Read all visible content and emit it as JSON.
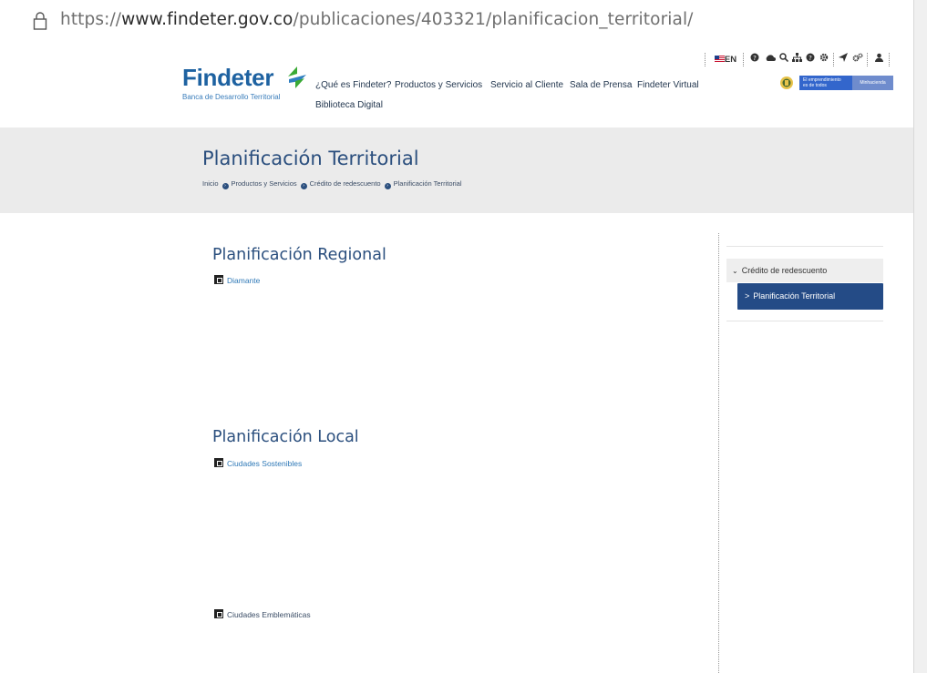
{
  "address_bar": {
    "url_prefix": "https://",
    "url_host": "www.findeter.gov.co",
    "url_path": "/publicaciones/403321/planificacion_territorial/"
  },
  "header": {
    "logo_text": "Findeter",
    "logo_subtitle": "Banca de Desarrollo Territorial",
    "nav": [
      {
        "label": "¿Qué es Findeter?"
      },
      {
        "label": "Productos y Servicios"
      },
      {
        "label": "Servicio al Cliente"
      },
      {
        "label": "Sala de Prensa"
      },
      {
        "label": "Findeter Virtual"
      },
      {
        "label": "Biblioteca Digital"
      }
    ],
    "toolbar": {
      "language": "EN",
      "icons": [
        "flag-us-icon",
        "help-circle-icon",
        "cloud-icon",
        "search-icon",
        "sitemap-icon",
        "question-icon",
        "gear-icon",
        "send-icon",
        "settings-icon",
        "user-icon"
      ]
    },
    "gov_banner": {
      "line1": "El emprendimiento",
      "line2": "es de todos",
      "ministry": "Minhacienda"
    }
  },
  "title_band": {
    "title": "Planificación Territorial",
    "breadcrumb": [
      "Inicio",
      "Productos y Servicios",
      "Crédito de redescuento",
      "Planificación Territorial"
    ]
  },
  "main": {
    "sections": [
      {
        "title": "Planificación Regional",
        "links": [
          "Diamante"
        ]
      },
      {
        "title": "Planificación Local",
        "links": [
          "Ciudades Sostenibles",
          "Ciudades Emblemáticas"
        ]
      }
    ]
  },
  "sidebar": {
    "parent": "Crédito de redescuento",
    "parent_chevron": "⌄",
    "active": "Planificación Territorial",
    "active_chevron": ">"
  },
  "colors": {
    "brand_blue": "#1e62a1",
    "title_blue": "#2b4f7e",
    "active_nav": "#244b86",
    "band_gray": "#ebebeb",
    "link_blue": "#2f79b7",
    "logo_green": "#3aaa35"
  }
}
